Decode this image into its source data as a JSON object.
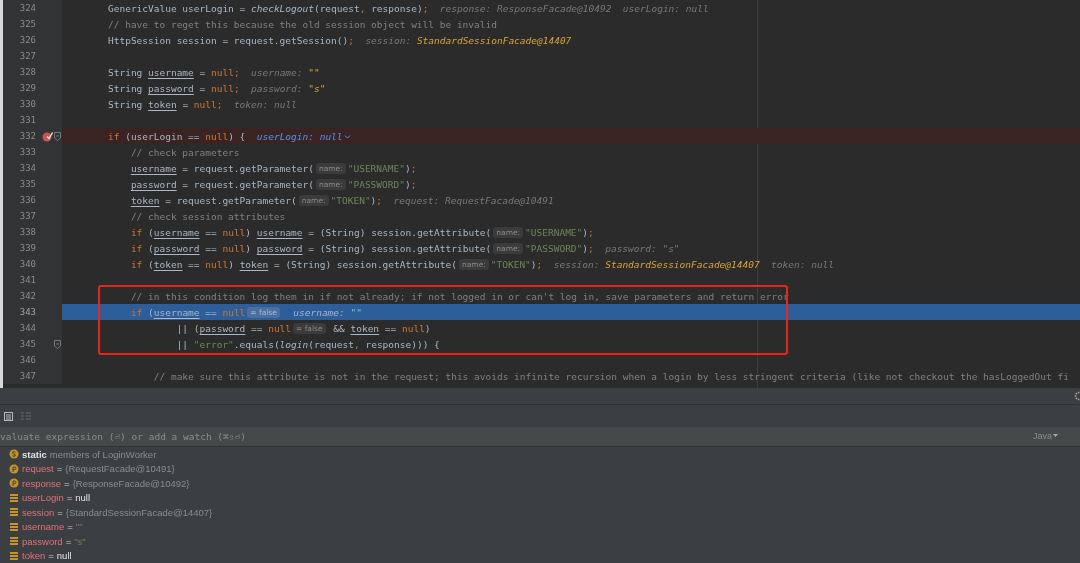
{
  "editor": {
    "lines": [
      {
        "no": "324",
        "kind": "normal",
        "marked": false,
        "fold": false,
        "tokens": [
          {
            "kind": "plain",
            "text": "GenericValue userLogin = "
          },
          {
            "kind": "method",
            "text": "checkLogout"
          },
          {
            "kind": "plain",
            "text": "(request"
          },
          {
            "kind": "punct",
            "text": ","
          },
          {
            "kind": "plain",
            "text": " response)"
          },
          {
            "kind": "punct",
            "text": ";"
          },
          {
            "kind": "hint",
            "text": "response:",
            "value": "ResponseFacade@10492",
            "accent": false
          },
          {
            "kind": "hint",
            "text": "userLogin:",
            "value": "null",
            "accent": false
          }
        ]
      },
      {
        "no": "325",
        "kind": "normal",
        "marked": false,
        "fold": false,
        "tokens": [
          {
            "kind": "comment",
            "text": "// have to reget this because the old session object will be invalid"
          }
        ]
      },
      {
        "no": "326",
        "kind": "normal",
        "marked": false,
        "fold": false,
        "tokens": [
          {
            "kind": "plain",
            "text": "HttpSession session = request.getSession()"
          },
          {
            "kind": "punct",
            "text": ";"
          },
          {
            "kind": "hint",
            "text": "session:",
            "value": "StandardSessionFacade@14407",
            "accent": true
          }
        ]
      },
      {
        "no": "327",
        "kind": "normal",
        "marked": false,
        "fold": false
      },
      {
        "no": "328",
        "kind": "normal",
        "marked": false,
        "fold": false,
        "tokens": [
          {
            "kind": "plain",
            "text": "String "
          },
          {
            "kind": "var",
            "text": "username"
          },
          {
            "kind": "plain",
            "text": " = "
          },
          {
            "kind": "kw",
            "text": "null"
          },
          {
            "kind": "punct",
            "text": ";"
          },
          {
            "kind": "hint",
            "text": "username:",
            "value": "\"\"",
            "accent": true
          }
        ]
      },
      {
        "no": "329",
        "kind": "normal",
        "marked": false,
        "fold": false,
        "tokens": [
          {
            "kind": "plain",
            "text": "String "
          },
          {
            "kind": "var",
            "text": "password"
          },
          {
            "kind": "plain",
            "text": " = "
          },
          {
            "kind": "kw",
            "text": "null"
          },
          {
            "kind": "punct",
            "text": ";"
          },
          {
            "kind": "hint",
            "text": "password:",
            "value": "\"s\"",
            "accent": true
          }
        ]
      },
      {
        "no": "330",
        "kind": "normal",
        "marked": false,
        "fold": false,
        "tokens": [
          {
            "kind": "plain",
            "text": "String "
          },
          {
            "kind": "var",
            "text": "token"
          },
          {
            "kind": "plain",
            "text": " = "
          },
          {
            "kind": "kw",
            "text": "null"
          },
          {
            "kind": "punct",
            "text": ";"
          },
          {
            "kind": "hint",
            "text": "token:",
            "value": "null",
            "accent": false
          }
        ]
      },
      {
        "no": "331",
        "kind": "normal",
        "marked": false,
        "fold": false
      },
      {
        "no": "332",
        "kind": "breakpoint",
        "marked": false,
        "fold": true,
        "tokens": [
          {
            "kind": "kw",
            "text": "if"
          },
          {
            "kind": "plain",
            "text": " (userLogin == "
          },
          {
            "kind": "kw",
            "text": "null"
          },
          {
            "kind": "plain",
            "text": ") {"
          },
          {
            "kind": "watch",
            "text": "userLogin: null"
          }
        ]
      },
      {
        "no": "333",
        "kind": "normal",
        "marked": false,
        "fold": false,
        "tokens": [
          {
            "kind": "comment",
            "text": "    // check parameters"
          }
        ]
      },
      {
        "no": "334",
        "kind": "normal",
        "marked": false,
        "fold": false,
        "tokens": [
          {
            "kind": "var",
            "text": "    username"
          },
          {
            "kind": "plain",
            "text": " = request.getParameter("
          },
          {
            "kind": "chip",
            "text": "name:"
          },
          {
            "kind": "str",
            "text": "\"USERNAME\""
          },
          {
            "kind": "plain",
            "text": ")"
          },
          {
            "kind": "punct",
            "text": ";"
          }
        ]
      },
      {
        "no": "335",
        "kind": "normal",
        "marked": false,
        "fold": false,
        "tokens": [
          {
            "kind": "var",
            "text": "    password"
          },
          {
            "kind": "plain",
            "text": " = request.getParameter("
          },
          {
            "kind": "chip",
            "text": "name:"
          },
          {
            "kind": "str",
            "text": "\"PASSWORD\""
          },
          {
            "kind": "plain",
            "text": ")"
          },
          {
            "kind": "punct",
            "text": ";"
          }
        ]
      },
      {
        "no": "336",
        "kind": "normal",
        "marked": false,
        "fold": false,
        "tokens": [
          {
            "kind": "var",
            "text": "    token"
          },
          {
            "kind": "plain",
            "text": " = request.getParameter("
          },
          {
            "kind": "chip",
            "text": "name:"
          },
          {
            "kind": "str",
            "text": "\"TOKEN\""
          },
          {
            "kind": "plain",
            "text": ")"
          },
          {
            "kind": "punct",
            "text": ";"
          },
          {
            "kind": "hint",
            "text": "request:",
            "value": "RequestFacade@10491",
            "accent": false
          }
        ]
      },
      {
        "no": "337",
        "kind": "normal",
        "marked": false,
        "fold": false,
        "tokens": [
          {
            "kind": "comment",
            "text": "    // check session attributes"
          }
        ]
      },
      {
        "no": "338",
        "kind": "normal",
        "marked": false,
        "fold": false,
        "tokens": [
          {
            "kind": "kw",
            "text": "    if"
          },
          {
            "kind": "plain",
            "text": " ("
          },
          {
            "kind": "var",
            "text": "username"
          },
          {
            "kind": "plain",
            "text": " == "
          },
          {
            "kind": "kw",
            "text": "null"
          },
          {
            "kind": "plain",
            "text": ") "
          },
          {
            "kind": "var",
            "text": "username"
          },
          {
            "kind": "plain",
            "text": " = (String) session.getAttribute("
          },
          {
            "kind": "chip",
            "text": "name:"
          },
          {
            "kind": "str",
            "text": "\"USERNAME\""
          },
          {
            "kind": "plain",
            "text": ")"
          },
          {
            "kind": "punct",
            "text": ";"
          }
        ]
      },
      {
        "no": "339",
        "kind": "normal",
        "marked": false,
        "fold": false,
        "tokens": [
          {
            "kind": "kw",
            "text": "    if"
          },
          {
            "kind": "plain",
            "text": " ("
          },
          {
            "kind": "var",
            "text": "password"
          },
          {
            "kind": "plain",
            "text": " == "
          },
          {
            "kind": "kw",
            "text": "null"
          },
          {
            "kind": "plain",
            "text": ") "
          },
          {
            "kind": "var",
            "text": "password"
          },
          {
            "kind": "plain",
            "text": " = (String) session.getAttribute("
          },
          {
            "kind": "chip",
            "text": "name:"
          },
          {
            "kind": "str",
            "text": "\"PASSWORD\""
          },
          {
            "kind": "plain",
            "text": ")"
          },
          {
            "kind": "punct",
            "text": ";"
          },
          {
            "kind": "hint",
            "text": "password:",
            "value": "\"s\"",
            "accent": false
          }
        ]
      },
      {
        "no": "340",
        "kind": "normal",
        "marked": false,
        "fold": false,
        "tokens": [
          {
            "kind": "kw",
            "text": "    if"
          },
          {
            "kind": "plain",
            "text": " ("
          },
          {
            "kind": "var",
            "text": "token"
          },
          {
            "kind": "plain",
            "text": " == "
          },
          {
            "kind": "kw",
            "text": "null"
          },
          {
            "kind": "plain",
            "text": ") "
          },
          {
            "kind": "var",
            "text": "token"
          },
          {
            "kind": "plain",
            "text": " = (String) session.getAttribute("
          },
          {
            "kind": "chip",
            "text": "name:"
          },
          {
            "kind": "str",
            "text": "\"TOKEN\""
          },
          {
            "kind": "plain",
            "text": ")"
          },
          {
            "kind": "punct",
            "text": ";"
          },
          {
            "kind": "hint",
            "text": "session:",
            "value": "StandardSessionFacade@14407",
            "accent": true
          },
          {
            "kind": "hint",
            "text": "token:",
            "value": "null",
            "accent": false
          }
        ]
      },
      {
        "no": "341",
        "kind": "normal",
        "marked": false,
        "fold": false
      },
      {
        "no": "342",
        "kind": "normal",
        "marked": true,
        "fold": false,
        "tokens": [
          {
            "kind": "comment",
            "text": "    // in this condition log them in if not already; if not logged in or can't log in, save parameters and return error"
          }
        ]
      },
      {
        "no": "343",
        "kind": "execution",
        "marked": true,
        "fold": false,
        "tokens": [
          {
            "kind": "kw",
            "text": "    if"
          },
          {
            "kind": "plain",
            "text": " ("
          },
          {
            "kind": "var",
            "text": "username"
          },
          {
            "kind": "plain",
            "text": " == "
          },
          {
            "kind": "kw",
            "text": "null"
          },
          {
            "kind": "chip",
            "text": "= false"
          },
          {
            "kind": "hint",
            "text": "username:",
            "value": "\"\"",
            "accent": false
          }
        ]
      },
      {
        "no": "344",
        "kind": "normal",
        "marked": true,
        "fold": false,
        "tokens": [
          {
            "kind": "plain",
            "text": "            || ("
          },
          {
            "kind": "var",
            "text": "password"
          },
          {
            "kind": "plain",
            "text": " == "
          },
          {
            "kind": "kw",
            "text": "null"
          },
          {
            "kind": "chip",
            "text": "= false"
          },
          {
            "kind": "plain",
            "text": " && "
          },
          {
            "kind": "var",
            "text": "token"
          },
          {
            "kind": "plain",
            "text": " == "
          },
          {
            "kind": "kw",
            "text": "null"
          },
          {
            "kind": "plain",
            "text": ")"
          }
        ]
      },
      {
        "no": "345",
        "kind": "normal",
        "marked": true,
        "fold": true,
        "tokens": [
          {
            "kind": "plain",
            "text": "            || "
          },
          {
            "kind": "str",
            "text": "\"error\""
          },
          {
            "kind": "plain",
            "text": ".equals("
          },
          {
            "kind": "method",
            "text": "login"
          },
          {
            "kind": "plain",
            "text": "(request"
          },
          {
            "kind": "punct",
            "text": ","
          },
          {
            "kind": "plain",
            "text": " response))) {"
          }
        ]
      },
      {
        "no": "346",
        "kind": "normal",
        "marked": false,
        "fold": false
      },
      {
        "no": "347",
        "kind": "normal",
        "marked": false,
        "fold": false,
        "tokens": [
          {
            "kind": "comment",
            "text": "        // make sure this attribute is not in the request; this avoids infinite recursion when a login by less stringent criteria (like not checkout the hasLoggedOut fi"
          }
        ]
      }
    ]
  },
  "debugger": {
    "evaluate": {
      "placeholder": "valuate expression (⏎) or add a watch (⌘⇧⏎)"
    },
    "language": "Java",
    "variables": [
      {
        "kind": "static",
        "name": "static",
        "value": {
          "kind": "object",
          "text": "members of LoginWorker"
        }
      },
      {
        "kind": "param",
        "name": "request",
        "sign": "=",
        "value": {
          "kind": "object",
          "text": "{RequestFacade@10491}"
        }
      },
      {
        "kind": "param",
        "name": "response",
        "sign": "=",
        "value": {
          "kind": "object",
          "text": "{ResponseFacade@10492}"
        }
      },
      {
        "kind": "field",
        "name": "userLogin",
        "sign": "=",
        "value": {
          "kind": "null",
          "text": "null"
        }
      },
      {
        "kind": "field",
        "name": "session",
        "sign": "=",
        "value": {
          "kind": "object",
          "text": "{StandardSessionFacade@14407}"
        }
      },
      {
        "kind": "field",
        "name": "username",
        "sign": "=",
        "value": {
          "kind": "string",
          "text": "\"\""
        }
      },
      {
        "kind": "field",
        "name": "password",
        "sign": "=",
        "value": {
          "kind": "string",
          "text": "\"s\""
        }
      },
      {
        "kind": "field",
        "name": "token",
        "sign": "=",
        "value": {
          "kind": "null",
          "text": "null"
        }
      }
    ]
  }
}
